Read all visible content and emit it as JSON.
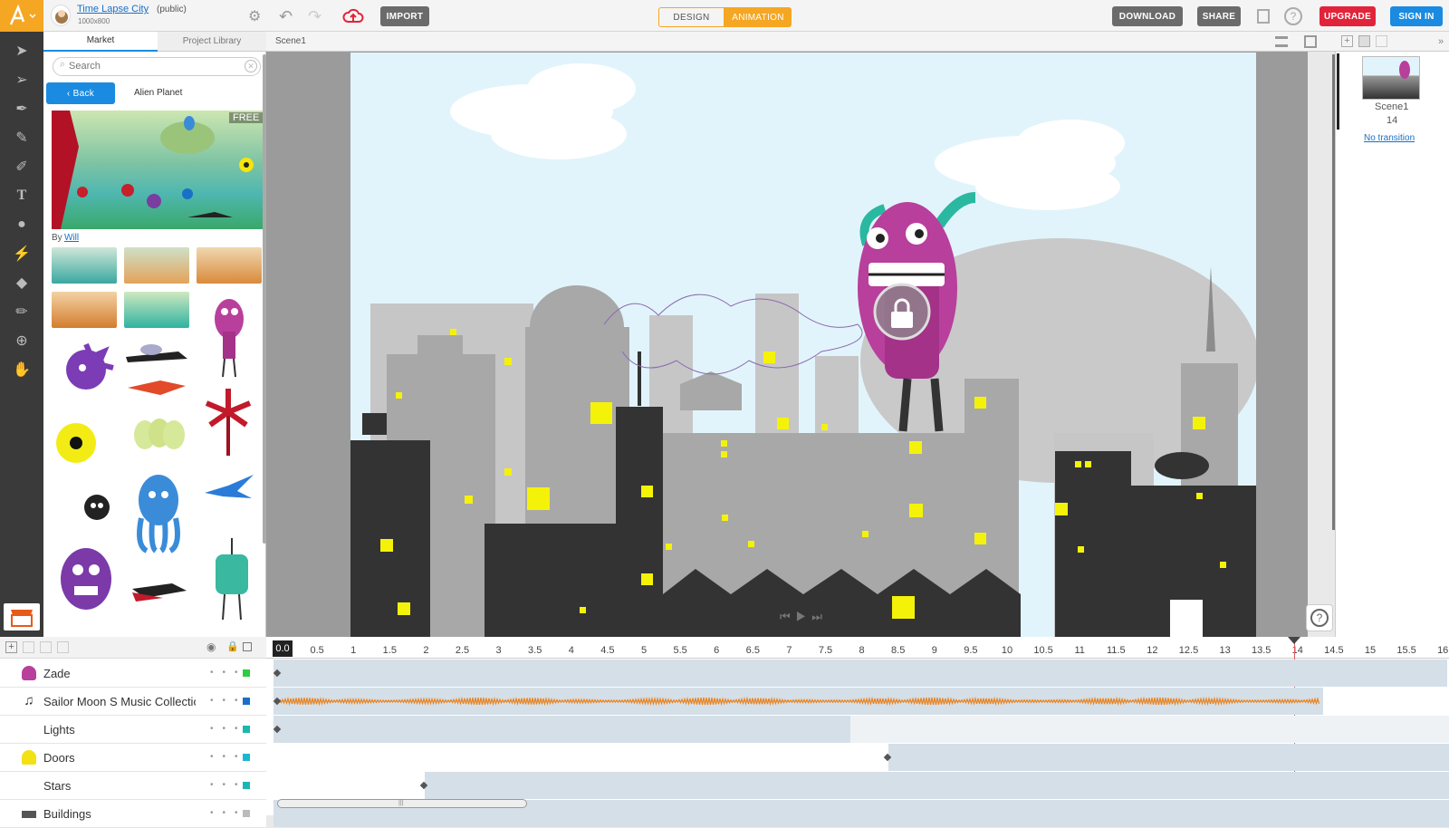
{
  "header": {
    "project_title": "Time Lapse City",
    "visibility": "(public)",
    "dimensions": "1000x800",
    "import_label": "IMPORT",
    "mode_design": "DESIGN",
    "mode_animation": "ANIMATION",
    "download_label": "DOWNLOAD",
    "share_label": "SHARE",
    "upgrade_label": "UPGRADE",
    "signin_label": "SIGN IN"
  },
  "panel": {
    "tab_market": "Market",
    "tab_library": "Project Library",
    "search_placeholder": "Search",
    "back_label": "Back",
    "category": "Alien Planet",
    "featured_badge": "FREE",
    "by_label": "By",
    "author": "Will"
  },
  "stage": {
    "breadcrumb": "Scene1"
  },
  "scenes": {
    "name": "Scene1",
    "frame": "14",
    "transition": "No transition"
  },
  "timeline": {
    "current_time": "0.0",
    "ticks": [
      "0.5",
      "1",
      "1.5",
      "2",
      "2.5",
      "3",
      "3.5",
      "4",
      "4.5",
      "5",
      "5.5",
      "6",
      "6.5",
      "7",
      "7.5",
      "8",
      "8.5",
      "9",
      "9.5",
      "10",
      "10.5",
      "11",
      "11.5",
      "12",
      "12.5",
      "13",
      "13.5",
      "14",
      "14.5",
      "15",
      "15.5",
      "16"
    ],
    "layers": [
      {
        "name": "Zade",
        "color": "#2ecc40"
      },
      {
        "name": "Sailor Moon S Music Collection",
        "color": "#1a6fc8"
      },
      {
        "name": "Lights",
        "color": "#1ab8b0"
      },
      {
        "name": "Doors",
        "color": "#1ab8d0"
      },
      {
        "name": "Stars",
        "color": "#1ab8b0"
      },
      {
        "name": "Buildings",
        "color": "#bbbbbb"
      }
    ]
  },
  "colors": {
    "brand": "#f5a623",
    "mode_active": "#f5a623",
    "upgrade": "#e2243a",
    "signin": "#1a8be0",
    "playhead": "#e05a5a",
    "waveform": "#e8821e"
  }
}
